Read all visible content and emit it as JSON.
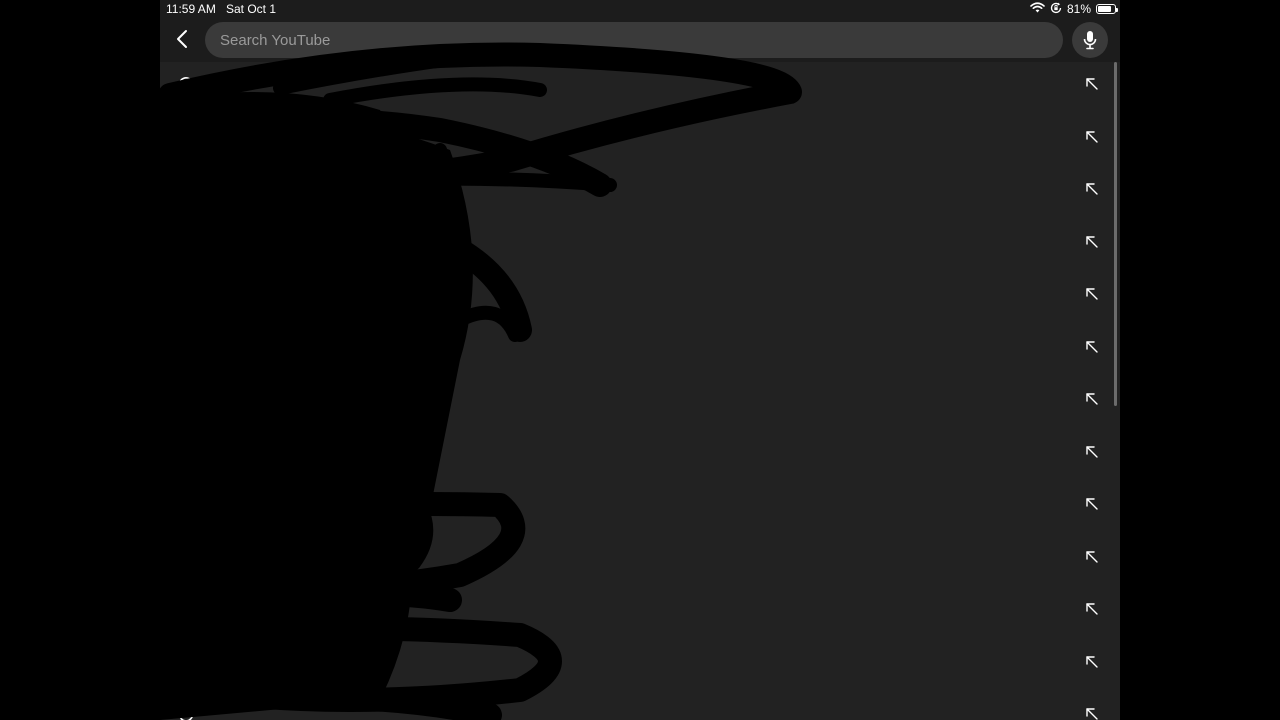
{
  "status_bar": {
    "time": "11:59 AM",
    "date": "Sat Oct 1",
    "battery_text": "81%",
    "battery_level": 0.81,
    "icons": [
      "wifi-icon",
      "orientation-lock-icon",
      "battery-icon"
    ]
  },
  "search": {
    "placeholder": "Search YouTube",
    "value": "",
    "back_icon": "chevron-left-icon",
    "mic_icon": "microphone-icon"
  },
  "suggestions": {
    "row_icon": "history-icon",
    "action_icon": "arrow-up-left-icon",
    "count": 13,
    "items": [
      "",
      "",
      "",
      "",
      "",
      "",
      "",
      "",
      "",
      "",
      "",
      "",
      ""
    ]
  },
  "colors": {
    "background": "#222222",
    "header": "#1c1c1c",
    "search_field": "#3a3a3a",
    "text": "#ffffff",
    "placeholder": "#9a9a9a",
    "redaction": "#000000"
  }
}
